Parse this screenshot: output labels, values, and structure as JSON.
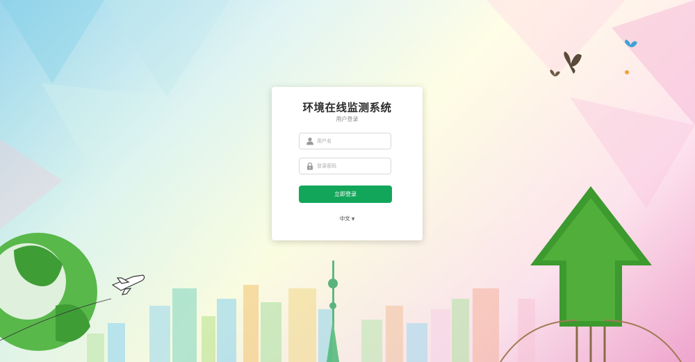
{
  "login": {
    "title": "环境在线监测系统",
    "subtitle": "用户登录",
    "username_placeholder": "用户名",
    "password_placeholder": "登录密码",
    "submit_label": "立即登录",
    "language": "中文",
    "language_caret": "▼"
  },
  "colors": {
    "primary_button": "#12a65a",
    "card_background": "#ffffff"
  },
  "icons": {
    "username": "user-icon",
    "password": "lock-icon",
    "language": "caret-down-icon"
  }
}
